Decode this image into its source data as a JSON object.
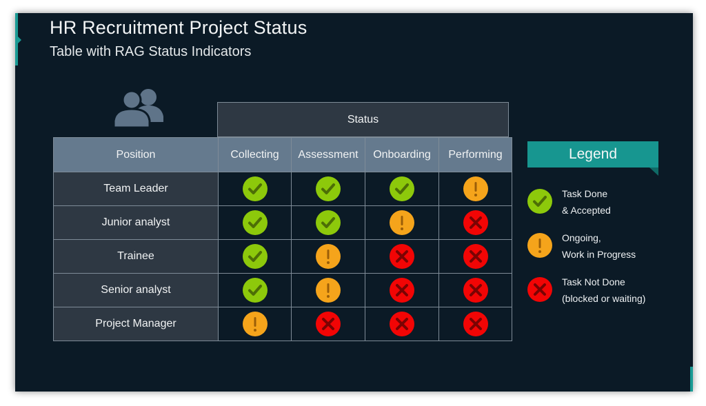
{
  "slide": {
    "title": "HR Recruitment Project Status",
    "subtitle": "Table with RAG Status Indicators",
    "accent_color": "#1a9a94",
    "background_color": "#0b1a26"
  },
  "table": {
    "group_header": "Status",
    "columns": [
      "Position",
      "Collecting",
      "Assessment",
      "Onboarding",
      "Performing"
    ],
    "rows": [
      {
        "position": "Team Leader",
        "statuses": [
          "done",
          "done",
          "done",
          "ongoing"
        ]
      },
      {
        "position": "Junior analyst",
        "statuses": [
          "done",
          "done",
          "ongoing",
          "not-done"
        ]
      },
      {
        "position": "Trainee",
        "statuses": [
          "done",
          "ongoing",
          "not-done",
          "not-done"
        ]
      },
      {
        "position": "Senior analyst",
        "statuses": [
          "done",
          "ongoing",
          "not-done",
          "not-done"
        ]
      },
      {
        "position": "Project Manager",
        "statuses": [
          "ongoing",
          "not-done",
          "not-done",
          "not-done"
        ]
      }
    ]
  },
  "legend": {
    "title": "Legend",
    "items": [
      {
        "status": "done",
        "icon": "check-icon",
        "color": "#8dc90b",
        "line1": "Task Done",
        "line2": "& Accepted"
      },
      {
        "status": "ongoing",
        "icon": "exclamation-icon",
        "color": "#f5a41b",
        "line1": "Ongoing,",
        "line2": "Work in Progress"
      },
      {
        "status": "not-done",
        "icon": "x-icon",
        "color": "#f20505",
        "line1": "Task Not Done",
        "line2": "(blocked or waiting)"
      }
    ]
  },
  "status_colors": {
    "done": "#8dc90b",
    "ongoing": "#f5a41b",
    "not-done": "#f20505"
  }
}
